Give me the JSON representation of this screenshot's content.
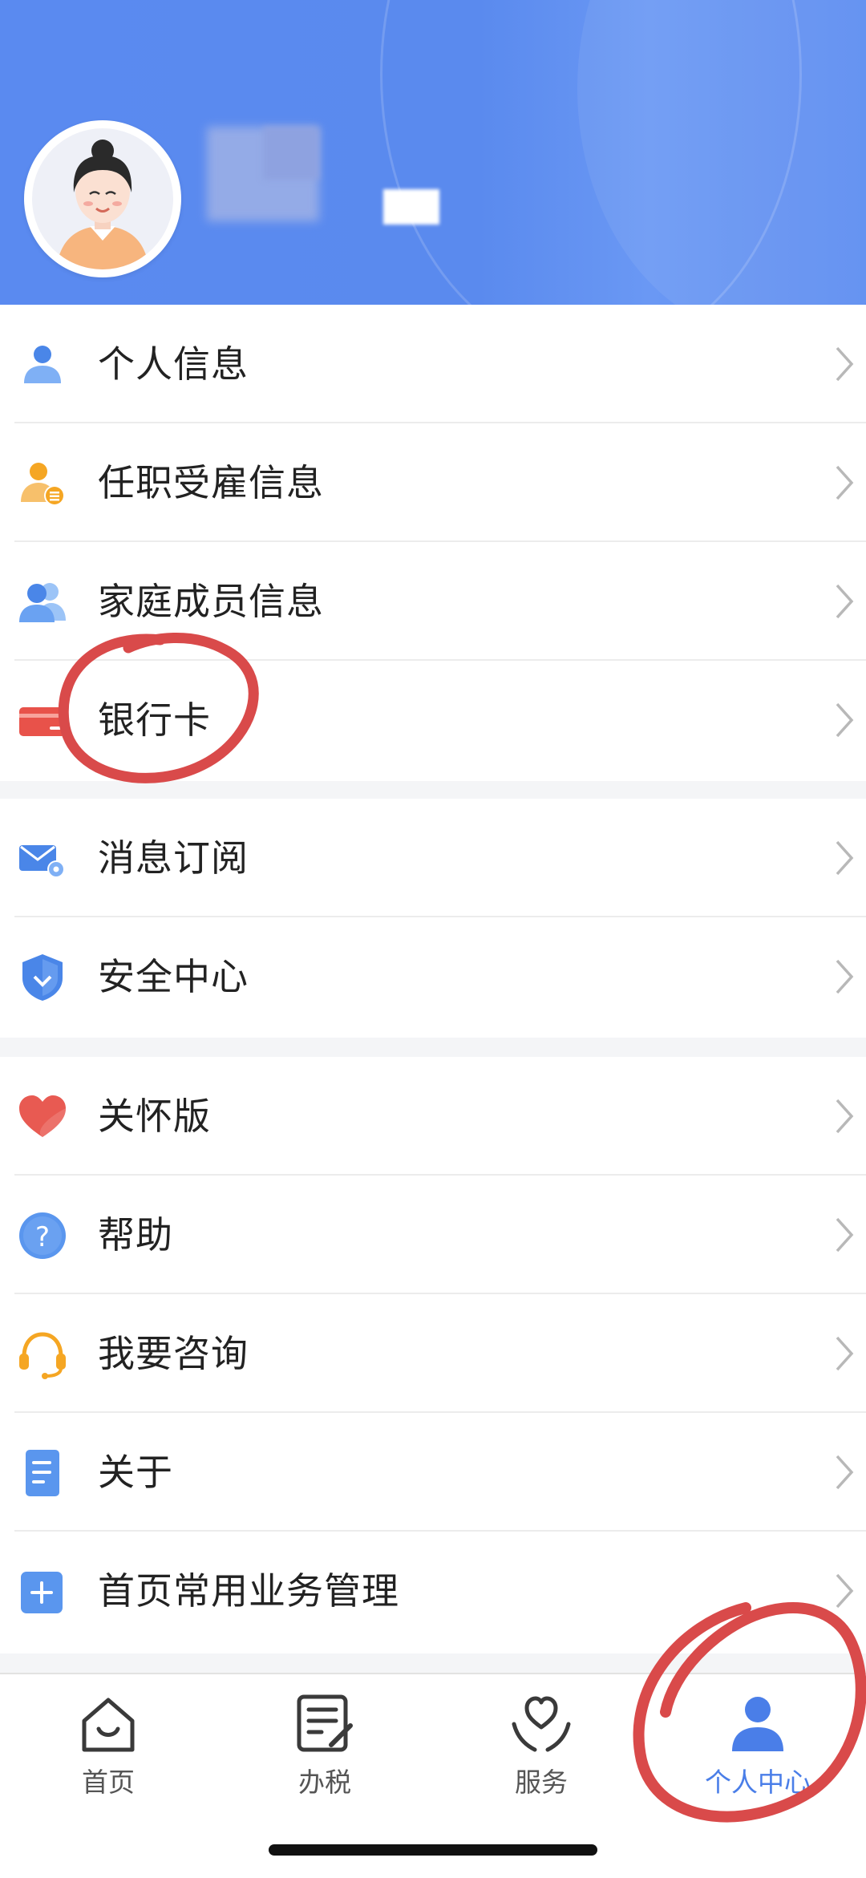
{
  "profile": {
    "name": ""
  },
  "menu_groups": [
    {
      "items": [
        {
          "label": "个人信息",
          "icon": "person-icon"
        },
        {
          "label": "任职受雇信息",
          "icon": "employment-icon"
        },
        {
          "label": "家庭成员信息",
          "icon": "family-icon"
        },
        {
          "label": "银行卡",
          "icon": "bank-card-icon"
        }
      ]
    },
    {
      "items": [
        {
          "label": "消息订阅",
          "icon": "mail-settings-icon"
        },
        {
          "label": "安全中心",
          "icon": "shield-icon"
        }
      ]
    },
    {
      "items": [
        {
          "label": "关怀版",
          "icon": "heart-icon"
        },
        {
          "label": "帮助",
          "icon": "help-icon"
        },
        {
          "label": "我要咨询",
          "icon": "headset-icon"
        },
        {
          "label": "关于",
          "icon": "document-icon"
        },
        {
          "label": "首页常用业务管理",
          "icon": "plus-square-icon"
        }
      ]
    }
  ],
  "tabbar": [
    {
      "label": "首页",
      "icon": "home-icon"
    },
    {
      "label": "办税",
      "icon": "tax-edit-icon"
    },
    {
      "label": "服务",
      "icon": "service-heart-icon"
    },
    {
      "label": "个人中心",
      "icon": "user-center-icon",
      "active": true
    }
  ],
  "colors": {
    "header": "#5a8af0",
    "accent": "#4a7ee8",
    "annotation": "#d94a4a"
  }
}
